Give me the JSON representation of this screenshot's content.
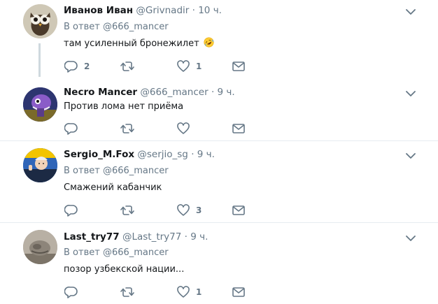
{
  "tweets": [
    {
      "name": "Иванов Иван",
      "handle": "@Grivnadir",
      "sep": "·",
      "time": "10 ч.",
      "reply_prefix": "В ответ",
      "reply_mention": "@666_mancer",
      "text": "там усиленный бронежилет",
      "emoji": "rolling-on-floor-laughing-emoji",
      "counts": {
        "reply": "2",
        "retweet": "",
        "like": "1"
      }
    },
    {
      "name": "Necro Mancer",
      "handle": "@666_mancer",
      "sep": "·",
      "time": "9 ч.",
      "text": "Против лома нет приёма",
      "counts": {
        "reply": "",
        "retweet": "",
        "like": ""
      }
    },
    {
      "name": "Sergio_M.Fox",
      "handle": "@serjio_sg",
      "sep": "·",
      "time": "9 ч.",
      "reply_prefix": "В ответ",
      "reply_mention": "@666_mancer",
      "text": "Смажений кабанчик",
      "counts": {
        "reply": "",
        "retweet": "",
        "like": "3"
      }
    },
    {
      "name": "Last_try77",
      "handle": "@Last_try77",
      "sep": "·",
      "time": "9 ч.",
      "reply_prefix": "В ответ",
      "reply_mention": "@666_mancer",
      "text": "позор узбекской нации...",
      "counts": {
        "reply": "",
        "retweet": "",
        "like": "1"
      }
    }
  ],
  "icons": {
    "reply": "reply-icon",
    "retweet": "retweet-icon",
    "like": "heart-icon",
    "dm": "envelope-icon",
    "more": "chevron-down-icon"
  },
  "colors": {
    "text": "#14171a",
    "secondary": "#657786",
    "divider": "#e6ecf0",
    "thread_line": "#cfd9de"
  }
}
